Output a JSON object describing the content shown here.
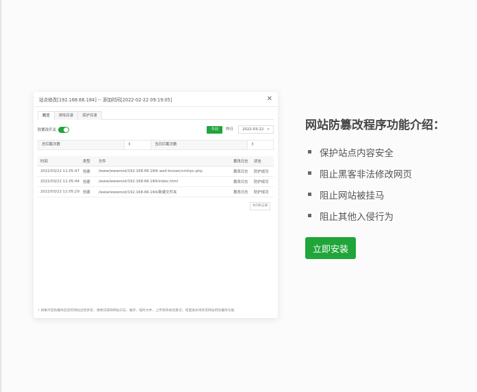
{
  "preview": {
    "title": "站点修改[192.168.66.184] -- 添加时间[2022-02-22 09:19:05]",
    "tabs": [
      "概览",
      "排除目录",
      "保护目录"
    ],
    "switch_label": "防篡改开关",
    "today_label": "今日",
    "yesterday_label": "昨日",
    "date_value": "2022-03-22",
    "stats": {
      "total_label": "总拦截次数",
      "total_value": "3",
      "today_label": "当日拦截次数",
      "today_value": "3"
    },
    "table": {
      "headers": [
        "时间",
        "类型",
        "文件",
        "篡改日志",
        "状态"
      ],
      "rows": [
        {
          "time": "2022/03/22 11:05:47",
          "type": "创建",
          "file": "/www/wwwroot/192.168.66.184/.well-known/xmlrpc.php",
          "log": "篡改日志",
          "status": "防护成功"
        },
        {
          "time": "2022/03/22 11:05:44",
          "type": "创建",
          "file": "/www/wwwroot/192.168.66.184/index.html",
          "log": "篡改日志",
          "status": "防护成功"
        },
        {
          "time": "2022/03/22 11:05:29",
          "type": "创建",
          "file": "/www/wwwroot/192.168.66.184/新建文件夹",
          "log": "篡改日志",
          "status": "防护成功"
        }
      ]
    },
    "pager_text": "共3条记录",
    "footnote": "• 如果开启防篡改后您的网站出现异常，请尝试排除网站日志、缓存、临时文件、上传等目录后重试，或直接关闭异常网站的防篡改功能"
  },
  "intro": {
    "title": "网站防篡改程序功能介绍：",
    "features": [
      "保护站点内容安全",
      "阻止黑客非法修改网页",
      "阻止网站被挂马",
      "阻止其他入侵行为"
    ],
    "install_label": "立即安装"
  },
  "colors": {
    "accent": "#20a53a"
  }
}
